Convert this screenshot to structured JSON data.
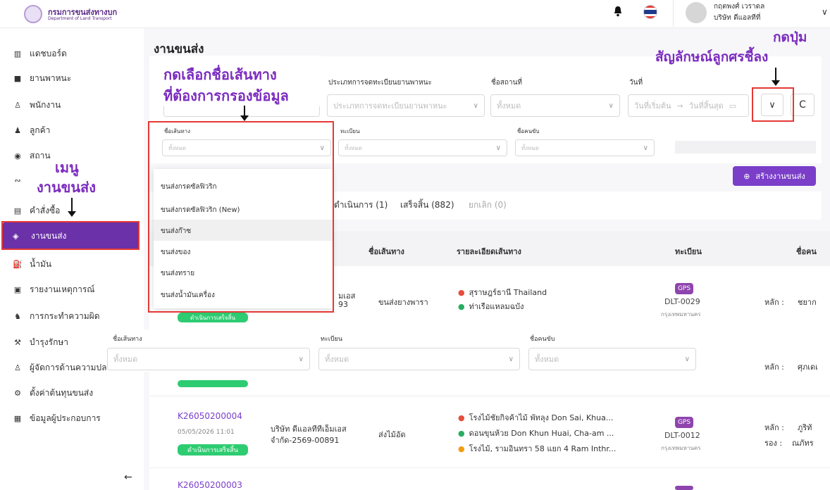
{
  "header": {
    "logo_th": "กรมการขนส่งทางบก",
    "logo_en": "Department of Land Transport",
    "user_name": "กฤตพงศ์ เวราดล",
    "user_company": "บริษัท ดีแอลทีที่"
  },
  "sidebar": {
    "items": [
      {
        "label": "แดชบอร์ด",
        "icon": "bar-chart-icon"
      },
      {
        "label": "ยานพาหนะ",
        "icon": "truck-icon"
      },
      {
        "label": "พนักงาน",
        "icon": "user-icon"
      },
      {
        "label": "ลูกค้า",
        "icon": "users-icon"
      },
      {
        "label": "สถาน",
        "icon": "pin-icon"
      },
      {
        "label": "",
        "icon": "route-icon"
      },
      {
        "label": "คำสั่งซื้อ",
        "icon": "clipboard-icon"
      },
      {
        "label": "งานขนส่ง",
        "icon": "box-icon"
      },
      {
        "label": "น้ำมัน",
        "icon": "fuel-icon"
      },
      {
        "label": "รายงานเหตุการณ์",
        "icon": "report-icon"
      },
      {
        "label": "การกระทำความผิด",
        "icon": "offense-icon"
      },
      {
        "label": "บำรุงรักษา",
        "icon": "wrench-icon"
      },
      {
        "label": "ผู้จัดการด้านความปลอ",
        "icon": "manager-icon"
      },
      {
        "label": "ตั้งค่าต้นทุนขนส่ง",
        "icon": "cog-icon"
      },
      {
        "label": "ข้อมูลผู้ประกอบการ",
        "icon": "building-icon"
      }
    ],
    "collapse_icon": "←"
  },
  "annotations": {
    "menu_line1": "เมนู",
    "menu_line2": "งานขนส่ง",
    "select_route_line1": "กดเลือกชื่อเส้นทาง",
    "select_route_line2": "ที่ต้องการกรองข้อมูล",
    "press_button_line1": "กดปุ่ม",
    "press_button_line2": "สัญลักษณ์ลูกศรชี้ลง"
  },
  "page": {
    "title": "งานขนส่ง"
  },
  "filters": {
    "reg_type_label": "ประเภทการจดทะเบียนยานพาหนะ",
    "reg_type_placeholder": "ประเภทการจดทะเบียนยานพาหนะ",
    "place_label": "ชื่อสถานที่",
    "place_placeholder": "ทั้งหมด",
    "date_label": "วันที่",
    "date_start": "วันที่เริ่มต้น",
    "date_arrow": "→",
    "date_end": "วันที่สิ้นสุด",
    "route_label": "ชื่อเส้นทาง",
    "route_placeholder": "ทั้งหมด",
    "plate_label": "ทะเบียน",
    "plate_placeholder": "ทั้งหมด",
    "driver_label": "ชื่อคนขับ",
    "driver_placeholder": "ทั้งหมด"
  },
  "route_dropdown": {
    "options": [
      "ขนส่งกรดซัลฟิวริก",
      "ขนส่งกรดซัลฟิวริก (New)",
      "ขนส่งก๊าซ",
      "ขนส่งของ",
      "ขนส่งทราย",
      "ขนส่งน้ำมันเครื่อง"
    ]
  },
  "create_button": "สร้างงานขนส่ง",
  "tabs": [
    "ดำเนินการ (1)",
    "เสร็จสิ้น (882)",
    "ยกเลิก (0)"
  ],
  "table": {
    "headers": [
      "ชื่อเส้นทาง",
      "รายละเอียดเส้นทาง",
      "ทะเบียน",
      "ชื่อคน"
    ],
    "row1": {
      "company_tail": "มเอส",
      "company_tail2": "93",
      "route": "ขนส่งยางพารา",
      "stops": [
        "สุราษฎร์ธานี Thailand",
        "ท่าเรือแหลมฉบัง"
      ],
      "gps": "GPS",
      "plate": "DLT-0029",
      "province": "กรุงเทพมหานคร",
      "driver_role": "หลัก :",
      "driver_name": "ชยาก",
      "status": "ดำเนินการเสร็จสิ้น"
    },
    "row2": {
      "driver_role": "หลัก :",
      "driver_name": "ศุภเดเ"
    },
    "row3": {
      "id": "K26050200004",
      "datetime": "05/05/2026 11:01",
      "status": "ดำเนินการเสร็จสิ้น",
      "company1": "บริษัท ดีแอลทีทีเอ็มเอส",
      "company2": "จำกัด-2569-00891",
      "route": "ส่งไม้อัด",
      "stops": [
        "โรงไม้ชัยกิจค้าไม้ พัทลุง Don Sai, Khua...",
        "ดอนขุนห้วย Don Khun Huai, Cha-am ...",
        "โรงไม้, รามอินทรา 58 แยก 4 Ram Inthr..."
      ],
      "gps": "GPS",
      "plate": "DLT-0012",
      "province": "กรุงเทพมหานคร",
      "driver_role1": "หลัก :",
      "driver_name1": "ภูริทั",
      "driver_role2": "รอง :",
      "driver_name2": "ณภัทร"
    },
    "row4": {
      "id": "K26050200003"
    }
  },
  "colors": {
    "accent": "#7a3ec9",
    "sidebar_active": "#6a31a8",
    "success": "#2ecc71",
    "annotation": "#e53935"
  }
}
